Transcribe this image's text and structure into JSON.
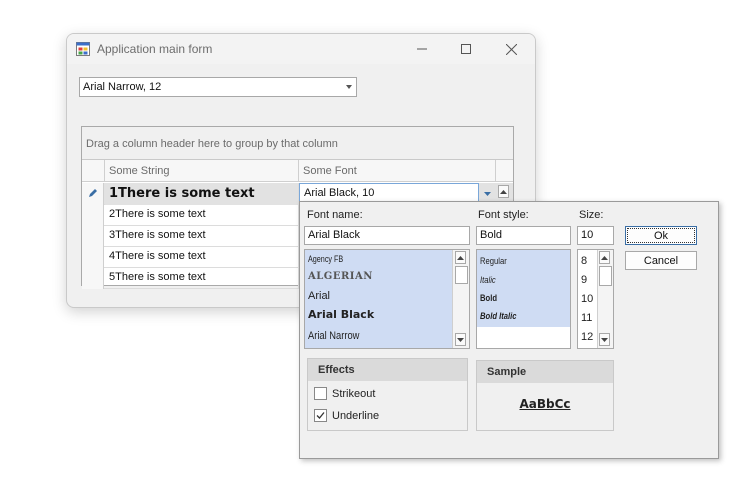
{
  "window": {
    "title": "Application main form",
    "font_combo_value": "Arial Narrow, 12"
  },
  "grid": {
    "group_panel_text": "Drag a column header here to group by that column",
    "columns": [
      "Some String",
      "Some Font"
    ],
    "rows": [
      {
        "text": "1There is some text",
        "font": "Arial Black, 10"
      },
      {
        "text": "2There is some text",
        "font": ""
      },
      {
        "text": "3There is some text",
        "font": ""
      },
      {
        "text": "4There is some text",
        "font": ""
      },
      {
        "text": "5There is some text",
        "font": ""
      }
    ]
  },
  "font_dialog": {
    "font_name_label": "Font name:",
    "font_style_label": "Font style:",
    "size_label": "Size:",
    "font_name_value": "Arial Black",
    "font_style_value": "Bold",
    "size_value": "10",
    "fonts": [
      "Agency FB",
      "ALGERIAN",
      "Arial",
      "Arial Black",
      "Arial Narrow"
    ],
    "styles": [
      "Regular",
      "Italic",
      "Bold",
      "Bold Italic"
    ],
    "sizes": [
      "8",
      "9",
      "10",
      "11",
      "12"
    ],
    "ok_label": "Ok",
    "cancel_label": "Cancel",
    "effects_label": "Effects",
    "strikeout_label": "Strikeout",
    "underline_label": "Underline",
    "strikeout_checked": false,
    "underline_checked": true,
    "sample_label": "Sample",
    "sample_text": "AaBbCc"
  }
}
